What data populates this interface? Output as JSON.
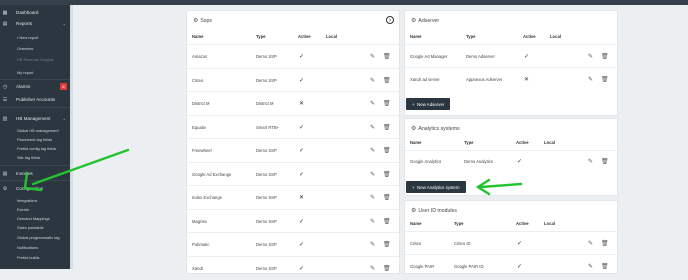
{
  "sidebar": {
    "dashboard": "Dashboard",
    "reports": "Reports",
    "reports_sub": [
      "New report",
      "Overview",
      "HB Revenue Insights",
      "My report"
    ],
    "alarms": "Alarms",
    "alarms_badge": "6",
    "publisher_accounts": "Publisher Accounts",
    "hb_management": "HB Management",
    "hb_sub": [
      "Global HB management",
      "Placement tag fields",
      "Prebid config tag fields",
      "Site tag fields"
    ],
    "invoices": "Invoices",
    "configuration": "Configuration",
    "config_sub": [
      "Integrations",
      "Events",
      "Demand Mappings",
      "Sales pos/table",
      "Global programmatic tag",
      "Notifications",
      "Prebid builds"
    ]
  },
  "ssps": {
    "title": "Ssps",
    "headers": [
      "Name",
      "Type",
      "Active",
      "Local"
    ],
    "rows": [
      {
        "name": "Amazon",
        "type": "Demo SSP",
        "active": "✓"
      },
      {
        "name": "Criteo",
        "type": "Demo SSP",
        "active": "✓"
      },
      {
        "name": "District M",
        "type": "District M",
        "active": "✕"
      },
      {
        "name": "Equativ",
        "type": "Smart RTB+",
        "active": "✓"
      },
      {
        "name": "Freewheel",
        "type": "Demo SSP",
        "active": "✓"
      },
      {
        "name": "Google Ad Exchange",
        "type": "Demo SSP",
        "active": "✓"
      },
      {
        "name": "Index Exchange",
        "type": "Demo SSP",
        "active": "✕"
      },
      {
        "name": "Magnite",
        "type": "Demo SSP",
        "active": "✓"
      },
      {
        "name": "Pubmatic",
        "type": "Demo SSP",
        "active": "✓"
      },
      {
        "name": "Xandr",
        "type": "Demo SSP",
        "active": "✓"
      }
    ]
  },
  "adservers": {
    "title": "Adserver",
    "headers": [
      "Name",
      "Type",
      "Active",
      "Local"
    ],
    "rows": [
      {
        "name": "Google Ad Manager",
        "type": "Demo Adserver",
        "active": "✓"
      },
      {
        "name": "Xandr ad server",
        "type": "Appnexus Adserver",
        "active": "✕"
      }
    ],
    "add_button": "New Adserver"
  },
  "analytics": {
    "title": "Analytics systems",
    "headers": [
      "Name",
      "Type",
      "Active",
      "Local"
    ],
    "rows": [
      {
        "name": "Google Analytics",
        "type": "Demo Analytics",
        "active": "✓"
      }
    ],
    "add_button": "New Analytics system"
  },
  "userid": {
    "title": "User ID modules",
    "headers": [
      "Name",
      "Type",
      "Active",
      "Local"
    ],
    "rows": [
      {
        "name": "Criteo",
        "type": "Criteo ID",
        "active": "✓"
      },
      {
        "name": "Google PAIR",
        "type": "Google PAIR ID",
        "active": "✓"
      }
    ]
  },
  "icons": {
    "edit": "pencil-icon",
    "delete": "trash-icon",
    "settings": "gear-icon",
    "help": "question-icon",
    "plus": "plus-icon"
  },
  "help_glyph": "?",
  "colors": {
    "sidebar": "#2b3640",
    "button": "#2b3640",
    "arrow": "#22c32e",
    "badge": "#e53935"
  }
}
